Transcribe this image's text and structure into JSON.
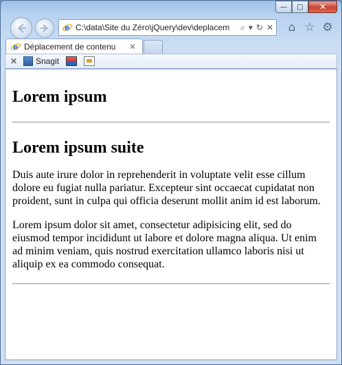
{
  "window": {
    "caption_buttons": {
      "minimize": "—",
      "maximize": "□",
      "close": "✕"
    }
  },
  "navigation": {
    "back_icon": "arrow-left-icon",
    "forward_icon": "arrow-right-icon",
    "address": {
      "url": "C:\\data\\Site du Zéro\\jQuery\\dev\\deplacem",
      "search_icon": "⌕",
      "dropdown_icon": "▾",
      "refresh_icon": "↻",
      "stop_icon": "✕"
    },
    "home_icon": "⌂",
    "favorites_icon": "☆",
    "tools_icon": "⚙"
  },
  "tabs": [
    {
      "title": "Déplacement de contenu",
      "close": "✕"
    }
  ],
  "command_bar": {
    "close": "✕",
    "snagit_label": "Snagit"
  },
  "page": {
    "heading1": "Lorem ipsum",
    "heading2": "Lorem ipsum suite",
    "paragraphs": [
      "Duis aute irure dolor in reprehenderit in voluptate velit esse cillum dolore eu fugiat nulla pariatur. Excepteur sint occaecat cupidatat non proident, sunt in culpa qui officia deserunt mollit anim id est laborum.",
      "Lorem ipsum dolor sit amet, consectetur adipisicing elit, sed do eiusmod tempor incididunt ut labore et dolore magna aliqua. Ut enim ad minim veniam, quis nostrud exercitation ullamco laboris nisi ut aliquip ex ea commodo consequat."
    ]
  }
}
